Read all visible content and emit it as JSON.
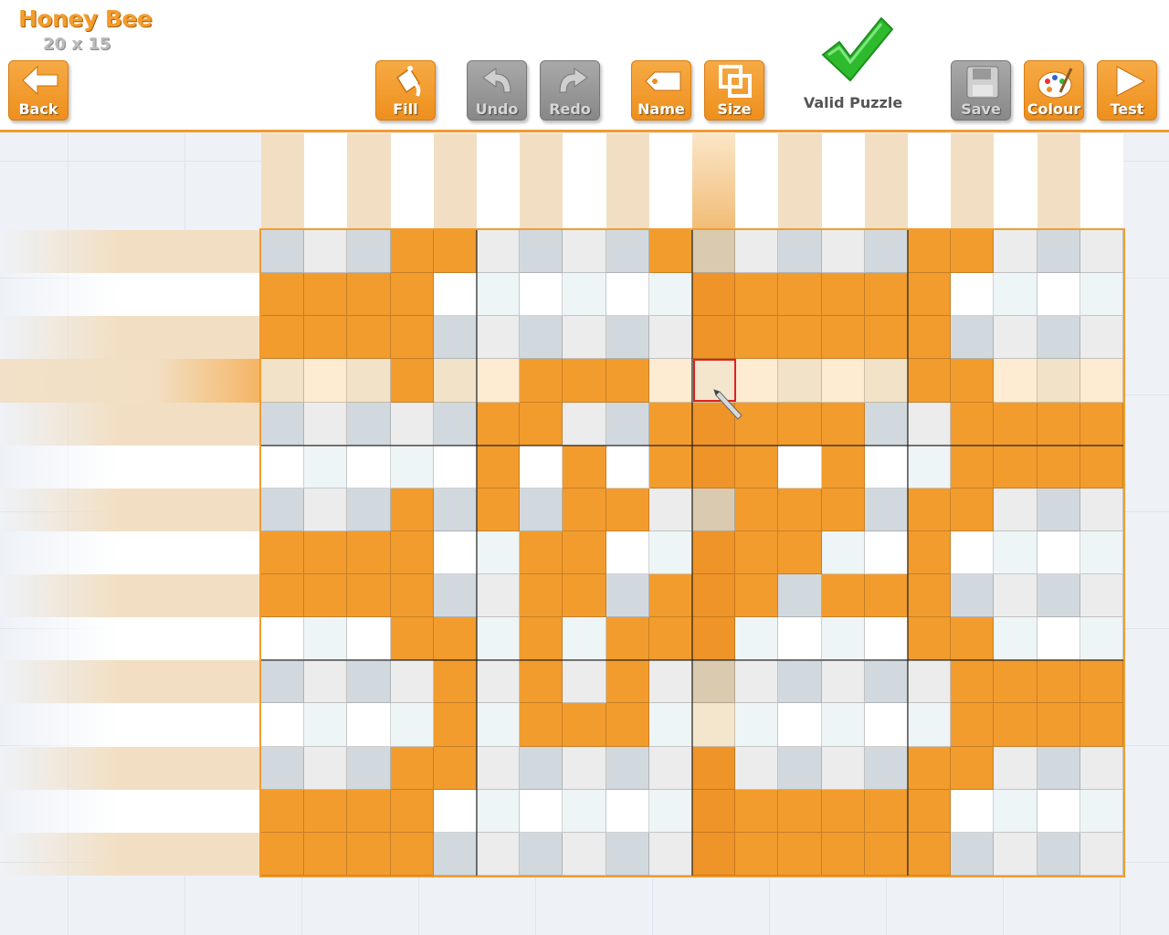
{
  "app": {
    "title": "Honey Bee",
    "size": "20 x 15"
  },
  "toolbar": {
    "back": "Back",
    "fill": "Fill",
    "undo": "Undo",
    "redo": "Redo",
    "name": "Name",
    "size": "Size",
    "save": "Save",
    "colour": "Colour",
    "test": "Test"
  },
  "status": {
    "label": "Valid Puzzle",
    "icon": "check-icon",
    "color": "#2dbb2d"
  },
  "colors": {
    "accent": "#f29c2e",
    "filled": "#f29c2e",
    "empty_light": "#ffffff",
    "empty_shade": "#e8e8e8",
    "selection": "#e02020"
  },
  "puzzle": {
    "columns": 20,
    "rows": 15,
    "selected": {
      "row": 3,
      "col": 10
    },
    "cells": [
      "00011000010000011000",
      "11110000001111110000",
      "11110000001111110000",
      "00010011100000011000",
      "00000110011111001111",
      "00000101011101001111",
      "00010101100111011000",
      "11110011001110010000",
      "11110011011101110000",
      "00011010111000011000",
      "00001010100000001111",
      "00001011100000001111",
      "00011000001000011000",
      "11110000001111110000",
      "11110000001111110000"
    ]
  }
}
